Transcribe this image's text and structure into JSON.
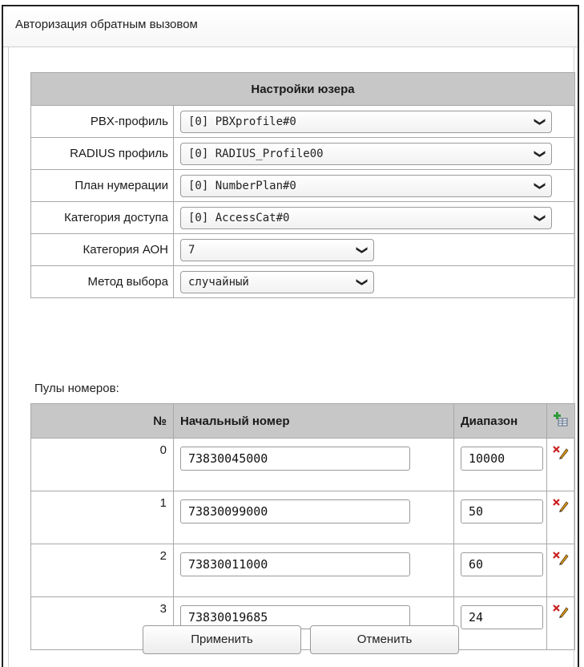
{
  "window": {
    "title": "Авторизация обратным вызовом"
  },
  "user_settings": {
    "header": "Настройки юзера",
    "rows": [
      {
        "label": "PBX-профиль",
        "value": "[0] PBXprofile#0"
      },
      {
        "label": "RADIUS профиль",
        "value": "[0] RADIUS_Profile00"
      },
      {
        "label": "План нумерации",
        "value": "[0] NumberPlan#0"
      },
      {
        "label": "Категория доступа",
        "value": "[0] AccessCat#0"
      },
      {
        "label": "Категория АОН",
        "value": "7"
      },
      {
        "label": "Метод выбора",
        "value": "случайный"
      }
    ]
  },
  "pools": {
    "label": "Пулы номеров:",
    "columns": {
      "num": "№",
      "start": "Начальный номер",
      "range": "Диапазон"
    },
    "rows": [
      {
        "num": "0",
        "start": "73830045000",
        "range": "10000"
      },
      {
        "num": "1",
        "start": "73830099000",
        "range": "50"
      },
      {
        "num": "2",
        "start": "73830011000",
        "range": "60"
      },
      {
        "num": "3",
        "start": "73830019685",
        "range": "24"
      }
    ]
  },
  "buttons": {
    "apply": "Применить",
    "cancel": "Отменить"
  },
  "icons": {
    "add": "add-row-icon",
    "delete": "delete-row-icon"
  }
}
